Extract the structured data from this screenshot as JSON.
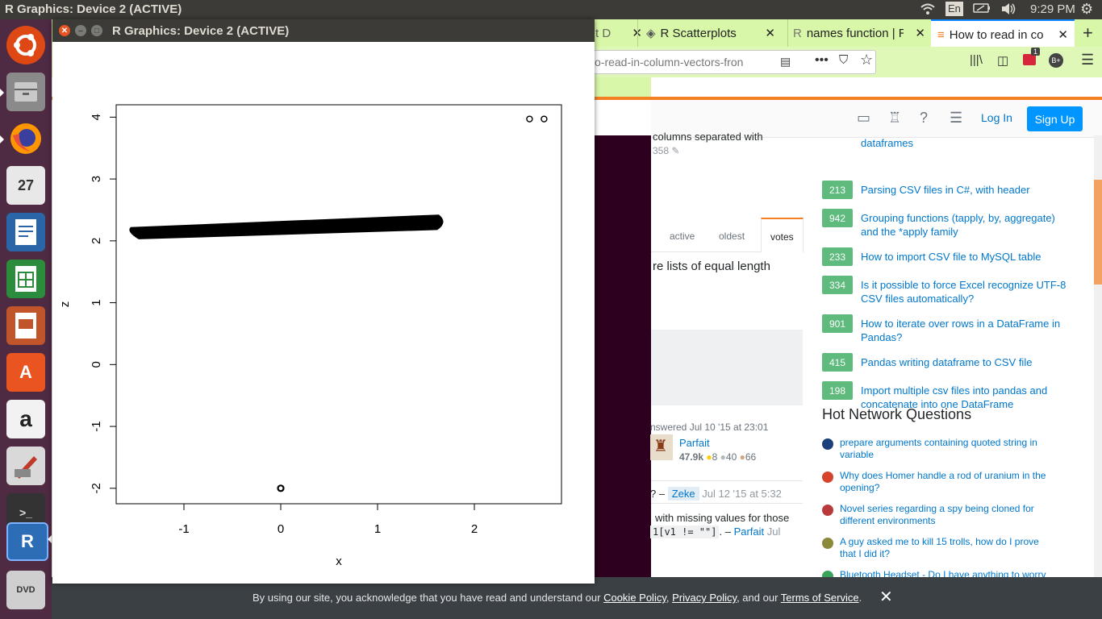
{
  "topbar": {
    "active_window": "R Graphics: Device 2 (ACTIVE)",
    "lang": "En",
    "time": "9:29 PM"
  },
  "launcher": {
    "items": [
      "ubuntu-dash",
      "files",
      "firefox",
      "calendar",
      "writer",
      "calc",
      "impress",
      "software-center",
      "amazon",
      "draw-tool",
      "terminal",
      "r-app",
      "dvd"
    ],
    "calendar_day": "27"
  },
  "browser": {
    "tabs": [
      {
        "label": "t D",
        "active": false
      },
      {
        "label": "R Scatterplots",
        "active": false
      },
      {
        "label": "names function | R",
        "active": false
      },
      {
        "label": "How to read in co",
        "active": true
      }
    ],
    "url": "o-read-in-column-vectors-fron",
    "badge": "1",
    "page": {
      "header": {
        "login": "Log In",
        "signup": "Sign Up"
      },
      "fragment_top": "columns separated with",
      "fragment_num": "358",
      "sort_tabs": [
        "active",
        "oldest",
        "votes"
      ],
      "fragment_q": "re lists of equal length",
      "answer_meta": "nswered Jul 10 '15 at 23:01",
      "user": {
        "name": "Parfait",
        "rep": "47.9k",
        "gold": "8",
        "silver": "40",
        "bronze": "66"
      },
      "comment1": {
        "prefix": "? –",
        "user": "Zeke",
        "date": "Jul 12 '15 at 5:32"
      },
      "comment2": {
        "text": "with missing values for those",
        "code": "1[v1 != \"\"]",
        "sep": ". –",
        "user": "Parfait",
        "date": "Jul"
      },
      "linked_top": "dataframes",
      "linked": [
        {
          "votes": "213",
          "title": "Parsing CSV files in C#, with header"
        },
        {
          "votes": "942",
          "title": "Grouping functions (tapply, by, aggregate) and the *apply family"
        },
        {
          "votes": "233",
          "title": "How to import CSV file to MySQL table"
        },
        {
          "votes": "334",
          "title": "Is it possible to force Excel recognize UTF-8 CSV files automatically?"
        },
        {
          "votes": "901",
          "title": "How to iterate over rows in a DataFrame in Pandas?"
        },
        {
          "votes": "415",
          "title": "Pandas writing dataframe to CSV file"
        },
        {
          "votes": "198",
          "title": "Import multiple csv files into pandas and concatenate into one DataFrame"
        }
      ],
      "hnq_title": "Hot Network Questions",
      "hnq": [
        "prepare arguments containing quoted string in variable",
        "Why does Homer handle a rod of uranium in the opening?",
        "Novel series regarding a spy being cloned for different environments",
        "A guy asked me to kill 15 trolls, how do I prove that I did it?",
        "Bluetooth Headset - Do I have anything to worry"
      ],
      "cookie": {
        "pre": "By using our site, you acknowledge that you have read and understand our",
        "cookie_policy": "Cookie Policy",
        "comma": ",",
        "privacy": "Privacy Policy",
        "and": ", and our",
        "terms": "Terms of Service",
        "end": ".",
        "close": "✕"
      }
    }
  },
  "r_window": {
    "title": "R Graphics: Device 2 (ACTIVE)",
    "chart_data": {
      "type": "scatter",
      "xlabel": "x",
      "ylabel": "z",
      "xlim": [
        -1.7,
        2.9
      ],
      "ylim": [
        -2.25,
        4.2
      ],
      "xticks": [
        "-1",
        "0",
        "1",
        "2"
      ],
      "yticks": [
        "-2",
        "-1",
        "0",
        "1",
        "2",
        "3",
        "4"
      ],
      "band": {
        "x_start": -1.55,
        "x_end": 1.7,
        "z_start": 2.15,
        "z_end": 2.3,
        "thickness": 0.25
      },
      "points": [
        {
          "x": 2.57,
          "z": 3.97
        },
        {
          "x": 2.72,
          "z": 3.97
        },
        {
          "x": 0.0,
          "z": -2.0
        }
      ]
    }
  }
}
